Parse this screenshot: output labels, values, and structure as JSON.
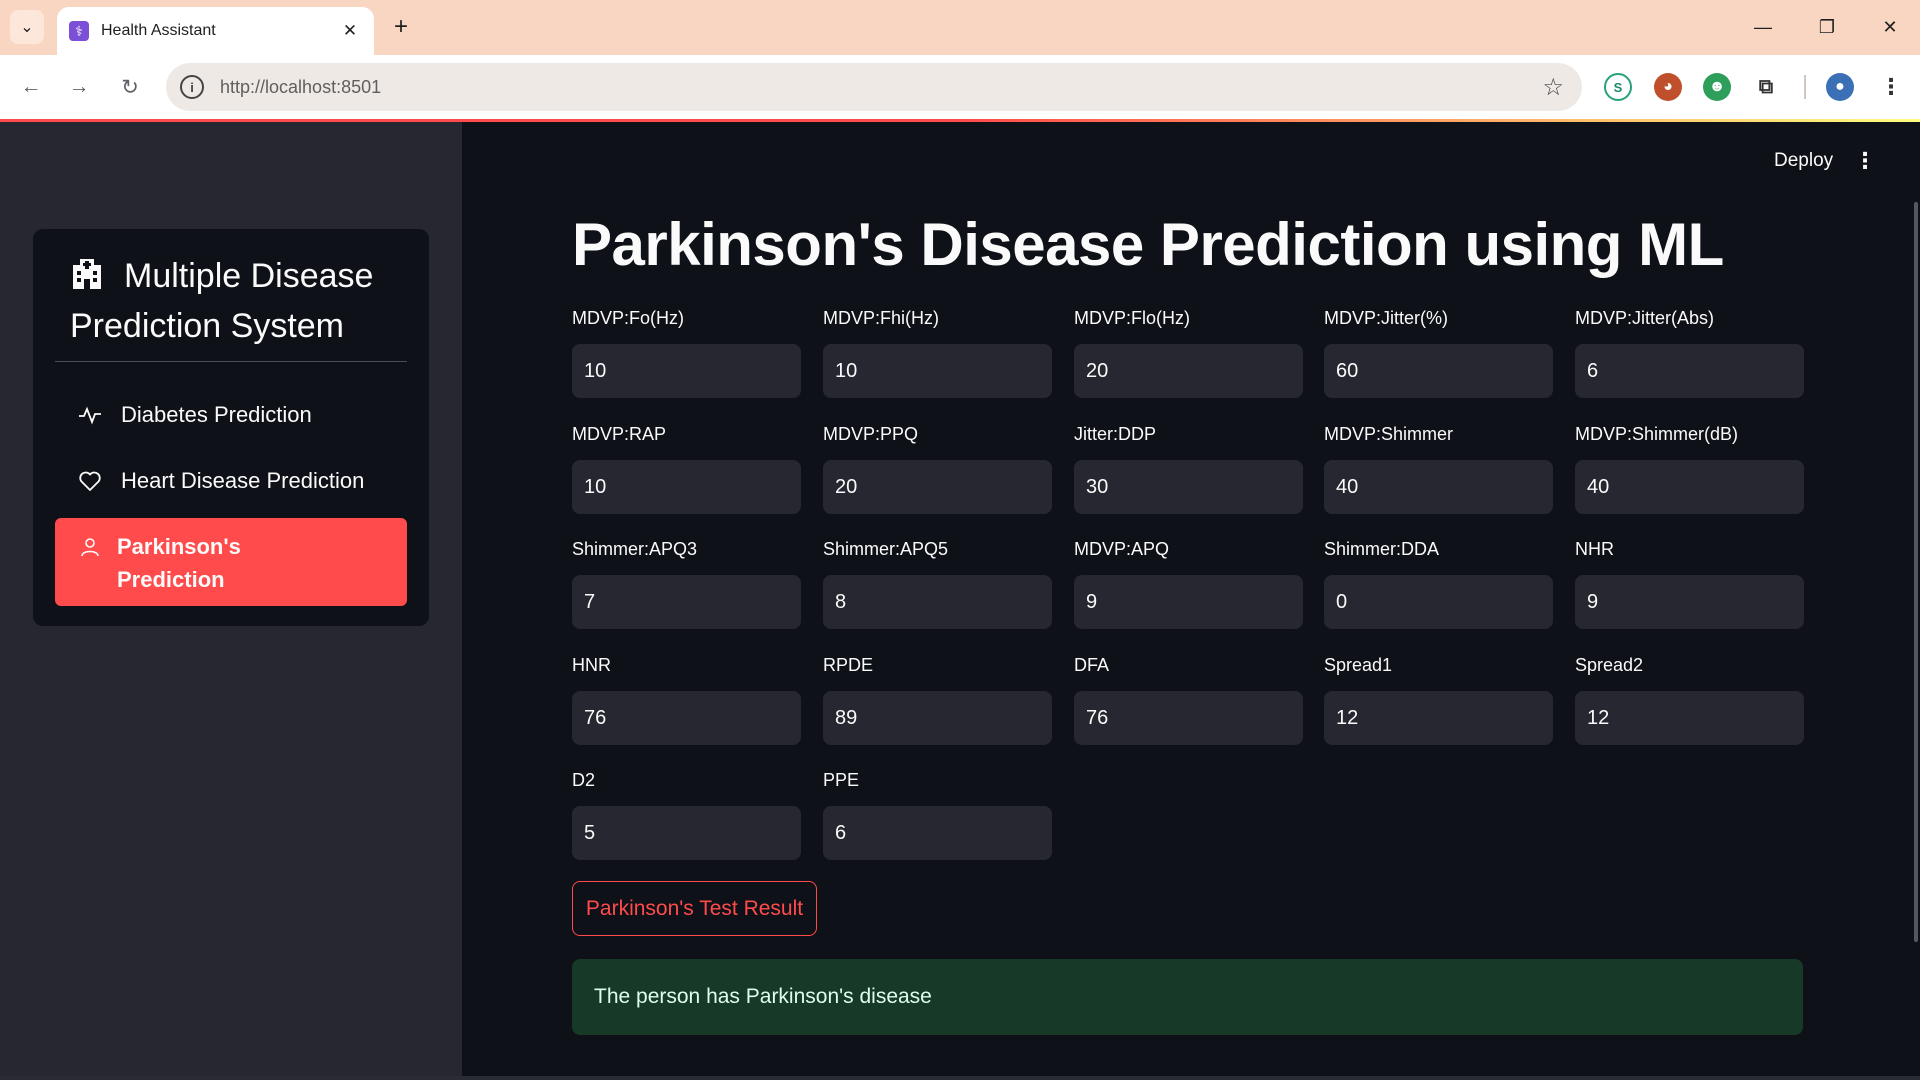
{
  "browser": {
    "tab_title": "Health Assistant",
    "url": "http://localhost:8501",
    "tab_close": "✕",
    "new_tab": "+",
    "minimize": "—",
    "restore": "❐",
    "close": "✕",
    "back": "←",
    "forward": "→",
    "reload": "↻",
    "star": "☆",
    "menu": "⋮"
  },
  "sidebar": {
    "header_line1": "Multiple Disease",
    "header_line2": "Prediction System",
    "items": [
      {
        "label": "Diabetes Prediction",
        "icon": "activity-icon",
        "active": false
      },
      {
        "label": "Heart Disease Prediction",
        "icon": "heart-icon",
        "active": false
      },
      {
        "label_line1": "Parkinson's",
        "label_line2": "Prediction",
        "icon": "person-icon",
        "active": true
      }
    ]
  },
  "header": {
    "deploy_label": "Deploy",
    "menu_icon": "⋮"
  },
  "main": {
    "title": "Parkinson's Disease Prediction using ML",
    "fields": [
      {
        "label": "MDVP:Fo(Hz)",
        "value": "10"
      },
      {
        "label": "MDVP:Fhi(Hz)",
        "value": "10"
      },
      {
        "label": "MDVP:Flo(Hz)",
        "value": "20"
      },
      {
        "label": "MDVP:Jitter(%)",
        "value": "60"
      },
      {
        "label": "MDVP:Jitter(Abs)",
        "value": "6"
      },
      {
        "label": "MDVP:RAP",
        "value": "10"
      },
      {
        "label": "MDVP:PPQ",
        "value": "20"
      },
      {
        "label": "Jitter:DDP",
        "value": "30"
      },
      {
        "label": "MDVP:Shimmer",
        "value": "40"
      },
      {
        "label": "MDVP:Shimmer(dB)",
        "value": "40"
      },
      {
        "label": "Shimmer:APQ3",
        "value": "7"
      },
      {
        "label": "Shimmer:APQ5",
        "value": "8"
      },
      {
        "label": "MDVP:APQ",
        "value": "9"
      },
      {
        "label": "Shimmer:DDA",
        "value": "0"
      },
      {
        "label": "NHR",
        "value": "9"
      },
      {
        "label": "HNR",
        "value": "76"
      },
      {
        "label": "RPDE",
        "value": "89"
      },
      {
        "label": "DFA",
        "value": "76"
      },
      {
        "label": "Spread1",
        "value": "12"
      },
      {
        "label": "Spread2",
        "value": "12"
      },
      {
        "label": "D2",
        "value": "5"
      },
      {
        "label": "PPE",
        "value": "6"
      }
    ],
    "button_label": "Parkinson's Test Result",
    "result_text": "The person has Parkinson's disease"
  },
  "colors": {
    "accent": "#ff4b4b",
    "background": "#0e1117",
    "sidebar": "#262730",
    "success_bg": "#173928"
  }
}
